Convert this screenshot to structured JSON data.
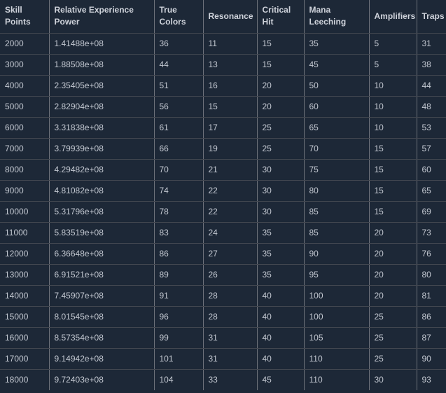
{
  "table": {
    "name": "skill-points-stat-progression-table",
    "columns": [
      {
        "key": "skill_points",
        "label": "Skill Points"
      },
      {
        "key": "relative_experience_power",
        "label": "Relative Experience Power"
      },
      {
        "key": "true_colors",
        "label": "True Colors"
      },
      {
        "key": "resonance",
        "label": "Resonance"
      },
      {
        "key": "critical_hit",
        "label": "Critical Hit"
      },
      {
        "key": "mana_leeching",
        "label": "Mana Leeching"
      },
      {
        "key": "amplifiers",
        "label": "Amplifiers"
      },
      {
        "key": "traps",
        "label": "Traps"
      }
    ],
    "rows": [
      [
        "2000",
        "1.41488e+08",
        "36",
        "11",
        "15",
        "35",
        "5",
        "31"
      ],
      [
        "3000",
        "1.88508e+08",
        "44",
        "13",
        "15",
        "45",
        "5",
        "38"
      ],
      [
        "4000",
        "2.35405e+08",
        "51",
        "16",
        "20",
        "50",
        "10",
        "44"
      ],
      [
        "5000",
        "2.82904e+08",
        "56",
        "15",
        "20",
        "60",
        "10",
        "48"
      ],
      [
        "6000",
        "3.31838e+08",
        "61",
        "17",
        "25",
        "65",
        "10",
        "53"
      ],
      [
        "7000",
        "3.79939e+08",
        "66",
        "19",
        "25",
        "70",
        "15",
        "57"
      ],
      [
        "8000",
        "4.29482e+08",
        "70",
        "21",
        "30",
        "75",
        "15",
        "60"
      ],
      [
        "9000",
        "4.81082e+08",
        "74",
        "22",
        "30",
        "80",
        "15",
        "65"
      ],
      [
        "10000",
        "5.31796e+08",
        "78",
        "22",
        "30",
        "85",
        "15",
        "69"
      ],
      [
        "11000",
        "5.83519e+08",
        "83",
        "24",
        "35",
        "85",
        "20",
        "73"
      ],
      [
        "12000",
        "6.36648e+08",
        "86",
        "27",
        "35",
        "90",
        "20",
        "76"
      ],
      [
        "13000",
        "6.91521e+08",
        "89",
        "26",
        "35",
        "95",
        "20",
        "80"
      ],
      [
        "14000",
        "7.45907e+08",
        "91",
        "28",
        "40",
        "100",
        "20",
        "81"
      ],
      [
        "15000",
        "8.01545e+08",
        "96",
        "28",
        "40",
        "100",
        "25",
        "86"
      ],
      [
        "16000",
        "8.57354e+08",
        "99",
        "31",
        "40",
        "105",
        "25",
        "87"
      ],
      [
        "17000",
        "9.14942e+08",
        "101",
        "31",
        "40",
        "110",
        "25",
        "90"
      ],
      [
        "18000",
        "9.72403e+08",
        "104",
        "33",
        "45",
        "110",
        "30",
        "93"
      ]
    ]
  },
  "colors": {
    "background": "#1d2837",
    "text": "#c3c8d1",
    "header_text": "#ced2da",
    "column_border": "#6d717a",
    "row_border": "#41464f"
  }
}
